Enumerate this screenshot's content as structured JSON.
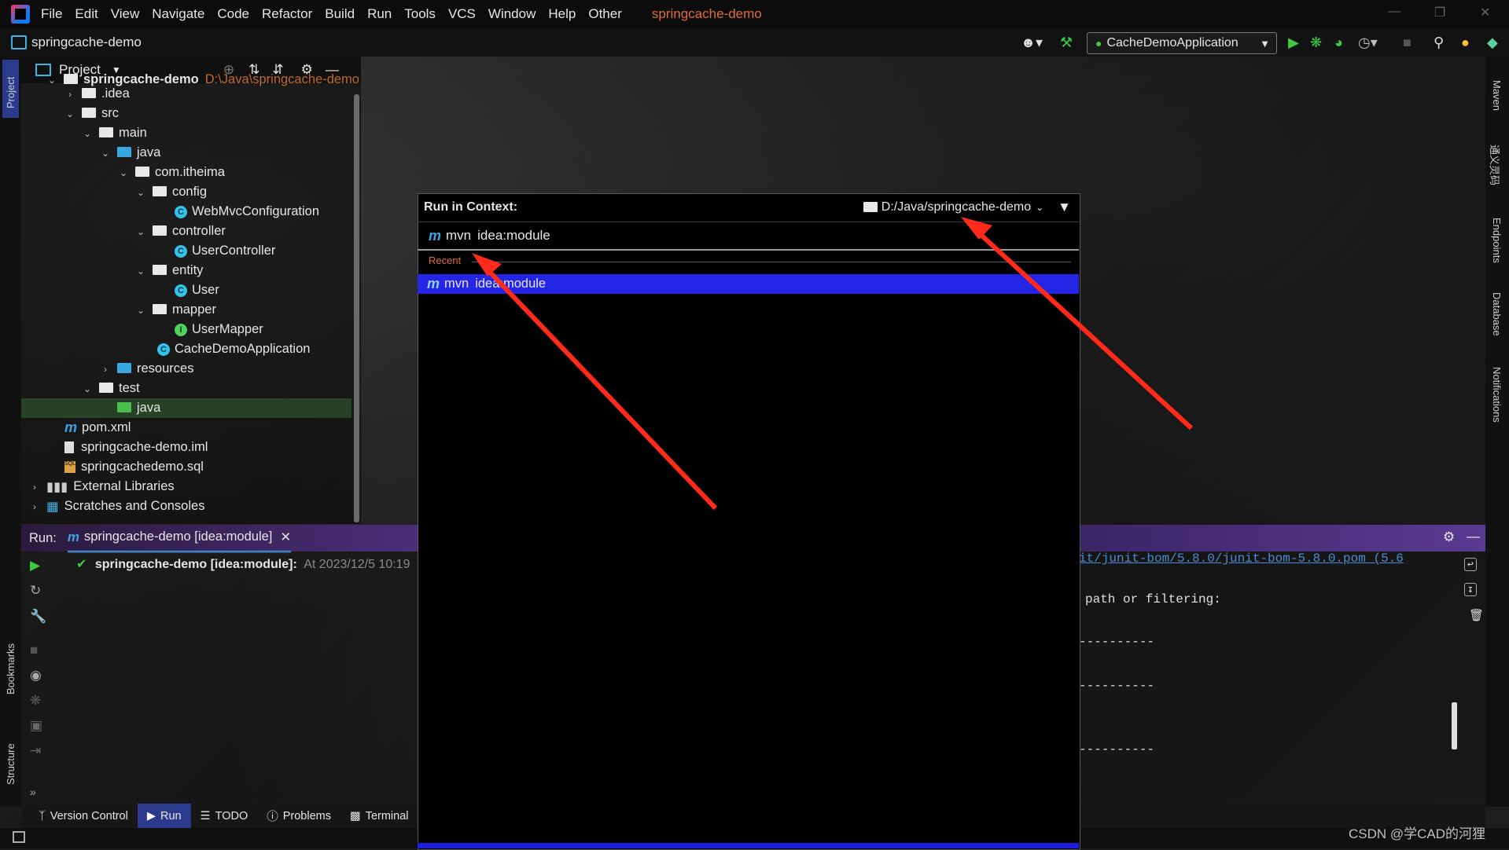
{
  "menu": {
    "items": [
      "File",
      "Edit",
      "View",
      "Navigate",
      "Code",
      "Refactor",
      "Build",
      "Run",
      "Tools",
      "VCS",
      "Window",
      "Help",
      "Other"
    ],
    "project_title": "springcache-demo"
  },
  "toolbar": {
    "project_name": "springcache-demo",
    "run_config": "CacheDemoApplication"
  },
  "project_panel": {
    "header": "Project",
    "root_name": "springcache-demo",
    "root_path": "D:\\Java\\springcache-demo",
    "items": [
      {
        "label": ".idea",
        "kind": "folder"
      },
      {
        "label": "src",
        "kind": "folder"
      },
      {
        "label": "main",
        "kind": "folder"
      },
      {
        "label": "java",
        "kind": "folder-blue"
      },
      {
        "label": "com.itheima",
        "kind": "package"
      },
      {
        "label": "config",
        "kind": "package"
      },
      {
        "label": "WebMvcConfiguration",
        "kind": "class"
      },
      {
        "label": "controller",
        "kind": "package"
      },
      {
        "label": "UserController",
        "kind": "class"
      },
      {
        "label": "entity",
        "kind": "package"
      },
      {
        "label": "User",
        "kind": "class"
      },
      {
        "label": "mapper",
        "kind": "package"
      },
      {
        "label": "UserMapper",
        "kind": "interface"
      },
      {
        "label": "CacheDemoApplication",
        "kind": "class"
      },
      {
        "label": "resources",
        "kind": "folder-blue"
      },
      {
        "label": "test",
        "kind": "folder"
      },
      {
        "label": "java",
        "kind": "folder-green"
      },
      {
        "label": "pom.xml",
        "kind": "maven"
      },
      {
        "label": "springcache-demo.iml",
        "kind": "file"
      },
      {
        "label": "springcachedemo.sql",
        "kind": "sql"
      },
      {
        "label": "External Libraries",
        "kind": "libs"
      },
      {
        "label": "Scratches and Consoles",
        "kind": "scratch"
      }
    ]
  },
  "run_panel": {
    "label": "Run:",
    "tab": "springcache-demo [idea:module]",
    "entry_title": "springcache-demo [idea:module]:",
    "entry_time": "At 2023/12/5 10:19"
  },
  "console": {
    "lines": [
      "it/junit-bom/5.8.0/junit-bom-5.8.0.pom (5.6",
      "path or filtering:",
      "----------",
      "----------",
      "----------"
    ]
  },
  "popup": {
    "title": "Run in Context:",
    "context_path": "D:/Java/springcache-demo",
    "command_prefix": "mvn",
    "command": "idea:module",
    "recent_label": "Recent",
    "recent_item_prefix": "mvn",
    "recent_item": "idea:module"
  },
  "bottom_tabs": [
    "Version Control",
    "Run",
    "TODO",
    "Problems",
    "Terminal"
  ],
  "left_tool_tabs": {
    "project": "Project",
    "bookmarks": "Bookmarks",
    "structure": "Structure"
  },
  "right_tool_tabs": {
    "maven": "Maven",
    "endpoints": "Endpoints",
    "database": "Database",
    "notifications": "Notifications",
    "cn": "通义灵码"
  },
  "watermark": "CSDN @学CAD的河狸",
  "colors": {
    "accent": "#2525e6",
    "arrow": "#ff2a1a",
    "title_orange": "#e06c3a",
    "run_green": "#3ec93e"
  }
}
